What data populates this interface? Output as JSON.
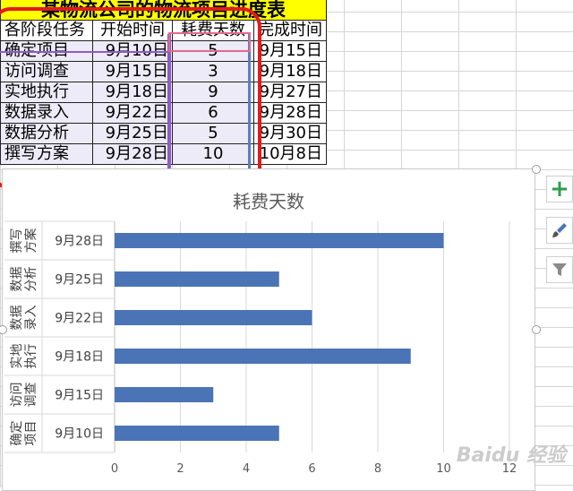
{
  "sheet": {
    "title": "某物流公司的物流项目进度表",
    "headers": [
      "各阶段任务",
      "开始时间",
      "耗费天数",
      "完成时间"
    ],
    "rows": [
      [
        "确定项目",
        "9月10日",
        "5",
        "9月15日"
      ],
      [
        "访问调查",
        "9月15日",
        "3",
        "9月18日"
      ],
      [
        "实地执行",
        "9月18日",
        "9",
        "9月27日"
      ],
      [
        "数据录入",
        "9月22日",
        "6",
        "9月28日"
      ],
      [
        "数据分析",
        "9月25日",
        "5",
        "9月30日"
      ],
      [
        "撰写方案",
        "9月28日",
        "10",
        "10月8日"
      ]
    ]
  },
  "chart_data": {
    "type": "bar",
    "orientation": "horizontal",
    "title": "耗费天数",
    "categories": [
      {
        "group": "确定项目",
        "label": "9月10日"
      },
      {
        "group": "访问调查",
        "label": "9月15日"
      },
      {
        "group": "实地执行",
        "label": "9月18日"
      },
      {
        "group": "数据录入",
        "label": "9月22日"
      },
      {
        "group": "数据分析",
        "label": "9月25日"
      },
      {
        "group": "撰写方案",
        "label": "9月28日"
      }
    ],
    "values": [
      5,
      3,
      9,
      6,
      5,
      10
    ],
    "xlim": [
      0,
      12
    ],
    "xticks": [
      0,
      2,
      4,
      6,
      8,
      10,
      12
    ],
    "grid": true,
    "bar_color": "#4a74b6"
  },
  "chart_tools": {
    "add_element": "+",
    "style": "brush",
    "filter": "filter"
  },
  "watermark": "Baidu 经验",
  "colors": {
    "highlight_ring": "#e21b1b",
    "title_fill": "#ffff00"
  }
}
